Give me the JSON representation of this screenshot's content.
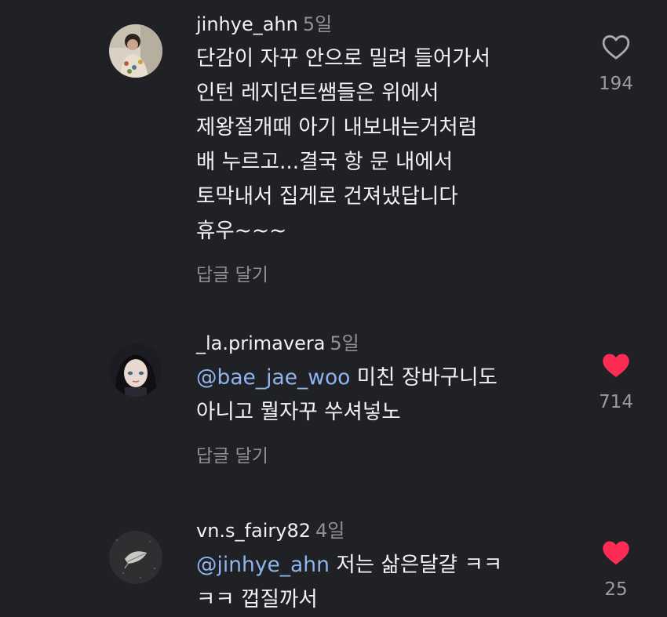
{
  "comments": [
    {
      "username": "jinhye_ahn",
      "time": "5일",
      "mention": "",
      "text": "단감이 자꾸 안으로 밀려 들어가서\n인턴 레지던트쌤들은 위에서\n제왕절개때 아기 내보내는거처럼\n배 누르고...결국 항 문 내에서\n토막내서 집게로 건져냈답니다\n휴우~~~",
      "reply_label": "답글 달기",
      "likes": "194",
      "liked": false,
      "avatar_icon": "profile-photo-person-cap"
    },
    {
      "username": "_la.primavera",
      "time": "5일",
      "mention": "@bae_jae_woo",
      "text": " 미친 장바구니도\n아니고 뭘자꾸 쑤셔넣노",
      "reply_label": "답글 달기",
      "likes": "714",
      "liked": true,
      "avatar_icon": "profile-photo-anime-girl"
    },
    {
      "username": "vn.s_fairy82",
      "time": "4일",
      "mention": "@jinhye_ahn",
      "text": " 저는 삶은달걀 ㅋㅋ\nㅋㅋ 껍질까서",
      "reply_label": "",
      "likes": "25",
      "liked": true,
      "avatar_icon": "profile-photo-leaf"
    }
  ],
  "colors": {
    "background": "#202125",
    "liked_heart": "#fe2c55",
    "mention": "#8fb4ee",
    "muted": "#8e9096"
  }
}
